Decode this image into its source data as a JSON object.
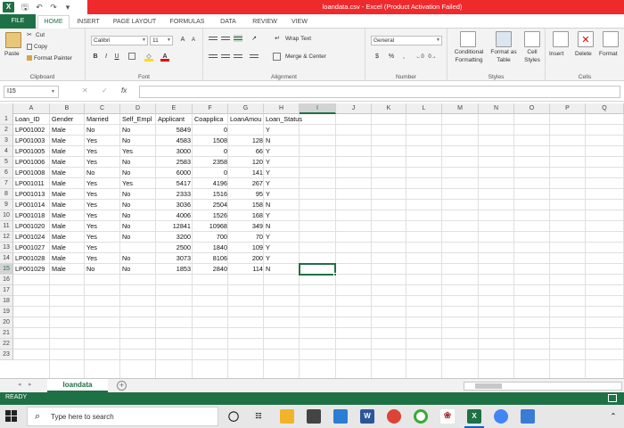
{
  "titlebar": {
    "title": "loandata.csv - Excel (Product Activation Failed)"
  },
  "tabs": [
    "FILE",
    "HOME",
    "INSERT",
    "PAGE LAYOUT",
    "FORMULAS",
    "DATA",
    "REVIEW",
    "VIEW"
  ],
  "ribbon": {
    "clipboard": {
      "paste": "Paste",
      "cut": "Cut",
      "copy": "Copy",
      "format_painter": "Format Painter",
      "label": "Clipboard"
    },
    "font": {
      "name": "Calibri",
      "size": "11",
      "bold": "B",
      "italic": "I",
      "underline": "U",
      "grow": "A",
      "shrink": "A",
      "label": "Font"
    },
    "alignment": {
      "wrap_text": "Wrap Text",
      "merge_center": "Merge & Center",
      "label": "Alignment"
    },
    "number": {
      "format": "General",
      "currency": "$",
      "percent": "%",
      "comma": ",",
      "label": "Number"
    },
    "styles": {
      "conditional": "Conditional",
      "conditional2": "Formatting",
      "format_as": "Format as",
      "format_as2": "Table",
      "cell": "Cell",
      "cell2": "Styles",
      "label": "Styles"
    },
    "cells": {
      "insert": "Insert",
      "delete": "Delete",
      "format": "Format",
      "label": "Cells"
    }
  },
  "formula_bar": {
    "name_box": "I15",
    "fx": "fx",
    "value": ""
  },
  "grid": {
    "columns": [
      "A",
      "B",
      "C",
      "D",
      "E",
      "F",
      "G",
      "H",
      "I",
      "J",
      "K",
      "L",
      "M",
      "N",
      "O",
      "P",
      "Q"
    ],
    "active_column": "I",
    "active_row": 15,
    "row_count": 23,
    "header_row": [
      "Loan_ID",
      "Gender",
      "Married",
      "Self_Empl",
      "Applicant",
      "Coapplica",
      "LoanAmou",
      "Loan_Status"
    ],
    "rows": [
      [
        "LP001002",
        "Male",
        "No",
        "No",
        "5849",
        "0",
        "",
        "Y"
      ],
      [
        "LP001003",
        "Male",
        "Yes",
        "No",
        "4583",
        "1508",
        "128",
        "N"
      ],
      [
        "LP001005",
        "Male",
        "Yes",
        "Yes",
        "3000",
        "0",
        "66",
        "Y"
      ],
      [
        "LP001006",
        "Male",
        "Yes",
        "No",
        "2583",
        "2358",
        "120",
        "Y"
      ],
      [
        "LP001008",
        "Male",
        "No",
        "No",
        "6000",
        "0",
        "141",
        "Y"
      ],
      [
        "LP001011",
        "Male",
        "Yes",
        "Yes",
        "5417",
        "4196",
        "267",
        "Y"
      ],
      [
        "LP001013",
        "Male",
        "Yes",
        "No",
        "2333",
        "1516",
        "95",
        "Y"
      ],
      [
        "LP001014",
        "Male",
        "Yes",
        "No",
        "3036",
        "2504",
        "158",
        "N"
      ],
      [
        "LP001018",
        "Male",
        "Yes",
        "No",
        "4006",
        "1526",
        "168",
        "Y"
      ],
      [
        "LP001020",
        "Male",
        "Yes",
        "No",
        "12841",
        "10968",
        "349",
        "N"
      ],
      [
        "LP001024",
        "Male",
        "Yes",
        "No",
        "3200",
        "700",
        "70",
        "Y"
      ],
      [
        "LP001027",
        "Male",
        "Yes",
        "",
        "2500",
        "1840",
        "109",
        "Y"
      ],
      [
        "LP001028",
        "Male",
        "Yes",
        "No",
        "3073",
        "8106",
        "200",
        "Y"
      ],
      [
        "LP001029",
        "Male",
        "No",
        "No",
        "1853",
        "2840",
        "114",
        "N"
      ]
    ]
  },
  "sheet": {
    "tab_name": "loandata",
    "add": "+"
  },
  "status": {
    "text": "READY"
  },
  "taskbar": {
    "search_placeholder": "Type here to search"
  },
  "colors": {
    "excel_green": "#1e7145",
    "title_red": "#ef2a2d"
  }
}
